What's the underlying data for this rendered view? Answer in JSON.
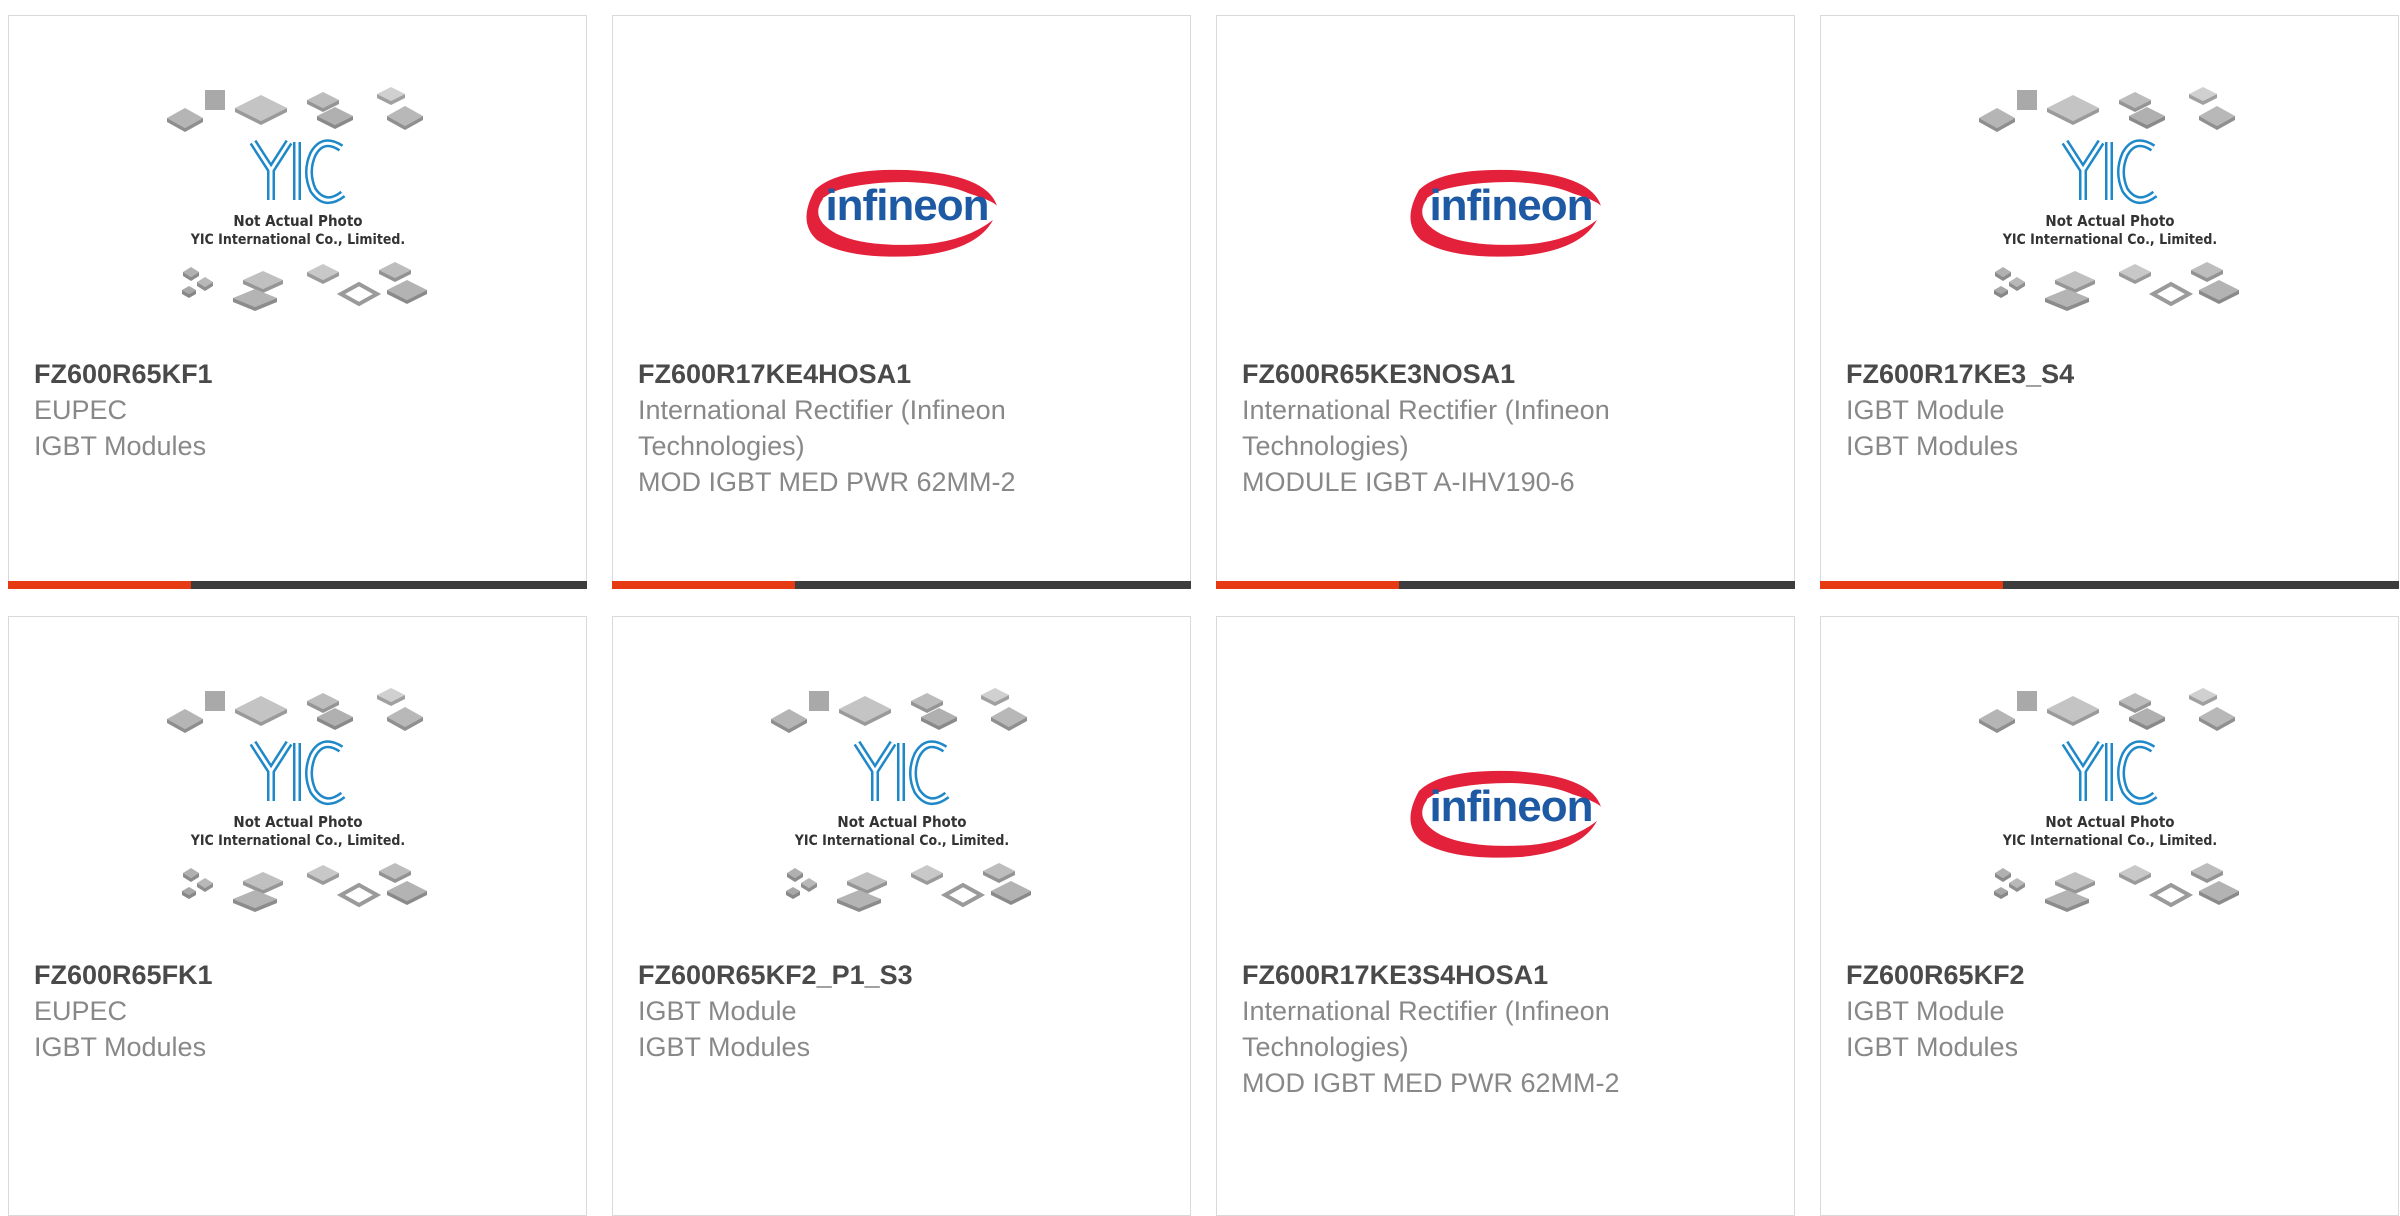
{
  "colors": {
    "accent": "#e63a12",
    "bar_dark": "#3d3d3d",
    "yic_logo": "#1e88c8",
    "infineon_text": "#1d5aa3",
    "infineon_swoosh": "#e4213a",
    "part_text": "#4a4a4a",
    "meta_text": "#888888"
  },
  "placeholder": {
    "line1": "Not Actual Photo",
    "line2": "YIC International Co., Limited.",
    "logo": "YIC"
  },
  "infineon_logo": {
    "text": "infineon"
  },
  "products": [
    {
      "part": "FZ600R65KF1",
      "manufacturer": "EUPEC",
      "description": "IGBT Modules",
      "image": "yic-placeholder"
    },
    {
      "part": "FZ600R17KE4HOSA1",
      "manufacturer": "International Rectifier (Infineon Technologies)",
      "description": "MOD IGBT MED PWR 62MM-2",
      "image": "infineon-logo"
    },
    {
      "part": "FZ600R65KE3NOSA1",
      "manufacturer": "International Rectifier (Infineon Technologies)",
      "description": "MODULE IGBT A-IHV190-6",
      "image": "infineon-logo"
    },
    {
      "part": "FZ600R17KE3_S4",
      "manufacturer": "IGBT Module",
      "description": "IGBT Modules",
      "image": "yic-placeholder"
    },
    {
      "part": "FZ600R65FK1",
      "manufacturer": "EUPEC",
      "description": "IGBT Modules",
      "image": "yic-placeholder"
    },
    {
      "part": "FZ600R65KF2_P1_S3",
      "manufacturer": "IGBT Module",
      "description": "IGBT Modules",
      "image": "yic-placeholder"
    },
    {
      "part": "FZ600R17KE3S4HOSA1",
      "manufacturer": "International Rectifier (Infineon Technologies)",
      "description": "MOD IGBT MED PWR 62MM-2",
      "image": "infineon-logo"
    },
    {
      "part": "FZ600R65KF2",
      "manufacturer": "IGBT Module",
      "description": "IGBT Modules",
      "image": "yic-placeholder"
    }
  ]
}
